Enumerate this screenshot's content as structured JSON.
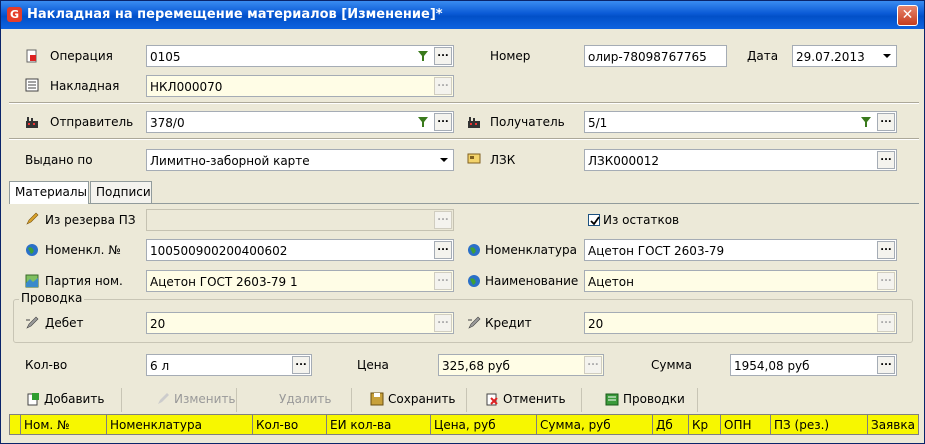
{
  "window": {
    "title": "Накладная на перемещение материалов [Изменение]*",
    "logo": "G",
    "close": "✕"
  },
  "header": {
    "operation_label": "Операция",
    "operation_value": "0105",
    "invoice_label": "Накладная",
    "invoice_value": "НКЛ000070",
    "number_label": "Номер",
    "number_value": "олир-78098767765",
    "date_label": "Дата",
    "date_value": "29.07.2013",
    "sender_label": "Отправитель",
    "sender_value": "378/0",
    "receiver_label": "Получатель",
    "receiver_value": "5/1",
    "issued_label": "Выдано по",
    "issued_value": "Лимитно-заборной карте",
    "lzk_label": "ЛЗК",
    "lzk_value": "ЛЗК000012"
  },
  "tabs": [
    {
      "label": "Материалы"
    },
    {
      "label": "Подписи"
    }
  ],
  "materials": {
    "reserve_label": "Из резерва ПЗ",
    "reserve_value": "",
    "from_stock_label": "Из остатков",
    "from_stock_checked": true,
    "nomen_no_label": "Номенкл. №",
    "nomen_no_value": "100500900200400602",
    "nomenclature_label": "Номенклатура",
    "nomenclature_value": "Ацетон ГОСТ 2603-79",
    "batch_label": "Партия ном.",
    "batch_value": "Ацетон ГОСТ 2603-79 1",
    "name_label": "Наименование",
    "name_value": "Ацетон",
    "posting_title": "Проводка",
    "debit_label": "Дебет",
    "debit_value": "20",
    "credit_label": "Кредит",
    "credit_value": "20",
    "qty_label": "Кол-во",
    "qty_value": "6 л",
    "price_label": "Цена",
    "price_value": "325,68 руб",
    "sum_label": "Сумма",
    "sum_value": "1954,08 руб"
  },
  "toolbar": {
    "add": "Добавить",
    "edit": "Изменить",
    "delete": "Удалить",
    "save": "Сохранить",
    "cancel": "Отменить",
    "postings": "Проводки"
  },
  "grid": {
    "columns": [
      "Ном. №",
      "Номенклатура",
      "Кол-во",
      "ЕИ кол-ва",
      "Цена, руб",
      "Сумма, руб",
      "Дб",
      "Кр",
      "ОПН",
      "ПЗ (рез.)",
      "Заявка"
    ]
  },
  "buttons": {
    "dots": "..."
  },
  "colors": {
    "titlebar": "#0a5ad6",
    "yellow_field": "#fffde6",
    "grid_header": "#f7f700"
  }
}
